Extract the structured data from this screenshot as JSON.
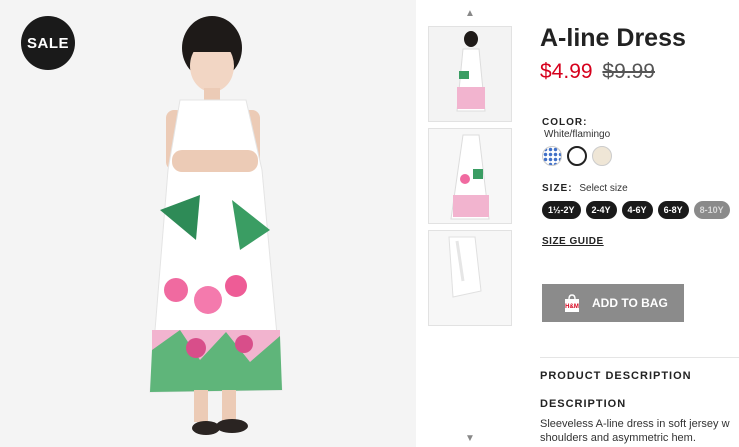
{
  "main_image": {
    "badge": "SALE",
    "alt": "Girl wearing white A-line dress with flamingo print"
  },
  "thumbnails": {
    "up_icon": "chevron-up-icon",
    "down_icon": "chevron-down-icon",
    "up_glyph": "▲",
    "down_glyph": "▼"
  },
  "product": {
    "title": "A-line Dress",
    "price_now": "$4.99",
    "price_was": "$9.99",
    "color_label": "COLOR:",
    "color_value": "White/flamingo",
    "size_label": "SIZE:",
    "size_hint": "Select size",
    "sizes": [
      {
        "label": "1½-2Y",
        "available": true
      },
      {
        "label": "2-4Y",
        "available": true
      },
      {
        "label": "4-6Y",
        "available": true
      },
      {
        "label": "6-8Y",
        "available": true
      },
      {
        "label": "8-10Y",
        "available": false
      }
    ],
    "size_guide": "SIZE GUIDE",
    "add_to_bag": "ADD TO BAG",
    "product_description_heading": "PRODUCT DESCRIPTION",
    "description_heading": "DESCRIPTION",
    "description_line1": "Sleeveless A-line dress in soft jersey w",
    "description_line2": "shoulders and asymmetric hem."
  },
  "colors": {
    "price_now": "#d6001c",
    "badge_bg": "#1a1a1a",
    "button_bg": "#8b8b8b",
    "size_pill": "#1a1a1a",
    "size_pill_disabled": "#8a8a8a"
  }
}
